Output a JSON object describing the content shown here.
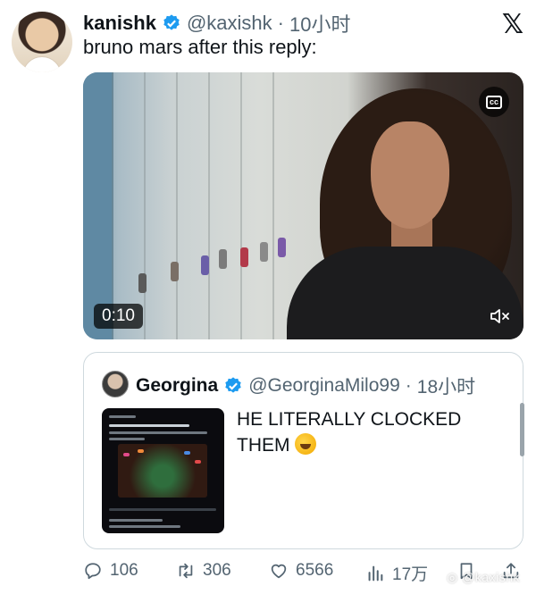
{
  "tweet": {
    "author_name": "kanishk",
    "author_handle": "@kaxishk",
    "separator": "·",
    "time": "10小时",
    "text": "bruno mars after this reply:"
  },
  "video": {
    "timestamp": "0:10",
    "cc_label": "cc"
  },
  "quoted_tweet": {
    "author_name": "Georgina",
    "author_handle": "@GeorginaMilo99",
    "separator": "·",
    "time": "18小时",
    "text": "HE LITERALLY CLOCKED THEM",
    "emoji": "rolling-on-floor-laughing"
  },
  "actions": {
    "replies": "106",
    "retweets": "306",
    "likes": "6566",
    "views": "17万"
  },
  "watermark": "@kaxishk",
  "colors": {
    "verified_blue": "#1d9bf0",
    "text_primary": "#0f1419",
    "text_secondary": "#536471",
    "border": "#cfd9de"
  }
}
